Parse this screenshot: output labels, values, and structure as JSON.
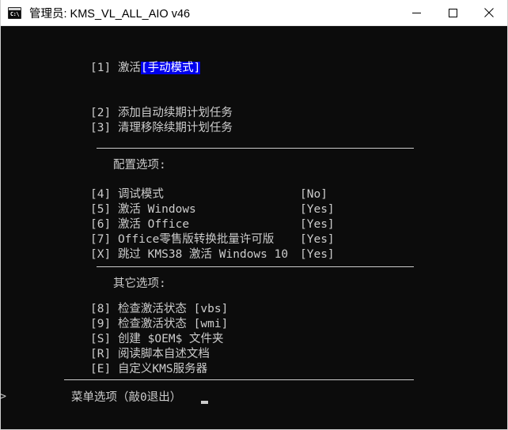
{
  "window": {
    "title": "管理员:  KMS_VL_ALL_AIO v46",
    "icon": "cmd-icon",
    "icon_glyph": "C:\\",
    "background_color": "#0c0c0c",
    "foreground_color": "#cccccc",
    "highlight_background": "#0000ee",
    "highlight_foreground": "#ffffff",
    "controls": {
      "minimize": "minimize-icon",
      "maximize": "maximize-icon",
      "close": "close-icon"
    }
  },
  "console": {
    "main_menu": [
      {
        "key": "[1]",
        "label": "激活",
        "highlight": "[手动模式]"
      },
      {
        "key": "[2]",
        "label": "添加自动续期计划任务",
        "highlight": ""
      },
      {
        "key": "[3]",
        "label": "清理移除续期计划任务",
        "highlight": ""
      }
    ],
    "config_section": {
      "heading": "配置选项:",
      "items": [
        {
          "key": "[4]",
          "label": "调试模式",
          "value": "[No]"
        },
        {
          "key": "[5]",
          "label": "激活 Windows",
          "value": "[Yes]"
        },
        {
          "key": "[6]",
          "label": "激活 Office",
          "value": "[Yes]"
        },
        {
          "key": "[7]",
          "label": "Office零售版转换批量许可版",
          "value": "[Yes]"
        },
        {
          "key": "[X]",
          "label": "跳过 KMS38 激活 Windows 10",
          "value": "[Yes]"
        }
      ]
    },
    "other_section": {
      "heading": "其它选项:",
      "items": [
        {
          "key": "[8]",
          "label": "检查激活状态 [vbs]"
        },
        {
          "key": "[9]",
          "label": "检查激活状态 [wmi]"
        },
        {
          "key": "[S]",
          "label": "创建 $OEM$ 文件夹"
        },
        {
          "key": "[R]",
          "label": "阅读脚本自述文档"
        },
        {
          "key": "[E]",
          "label": "自定义KMS服务器"
        }
      ]
    },
    "prompt": {
      "chevron": ">",
      "text": "菜单选项（敲0退出）",
      "cursor": "block"
    }
  }
}
